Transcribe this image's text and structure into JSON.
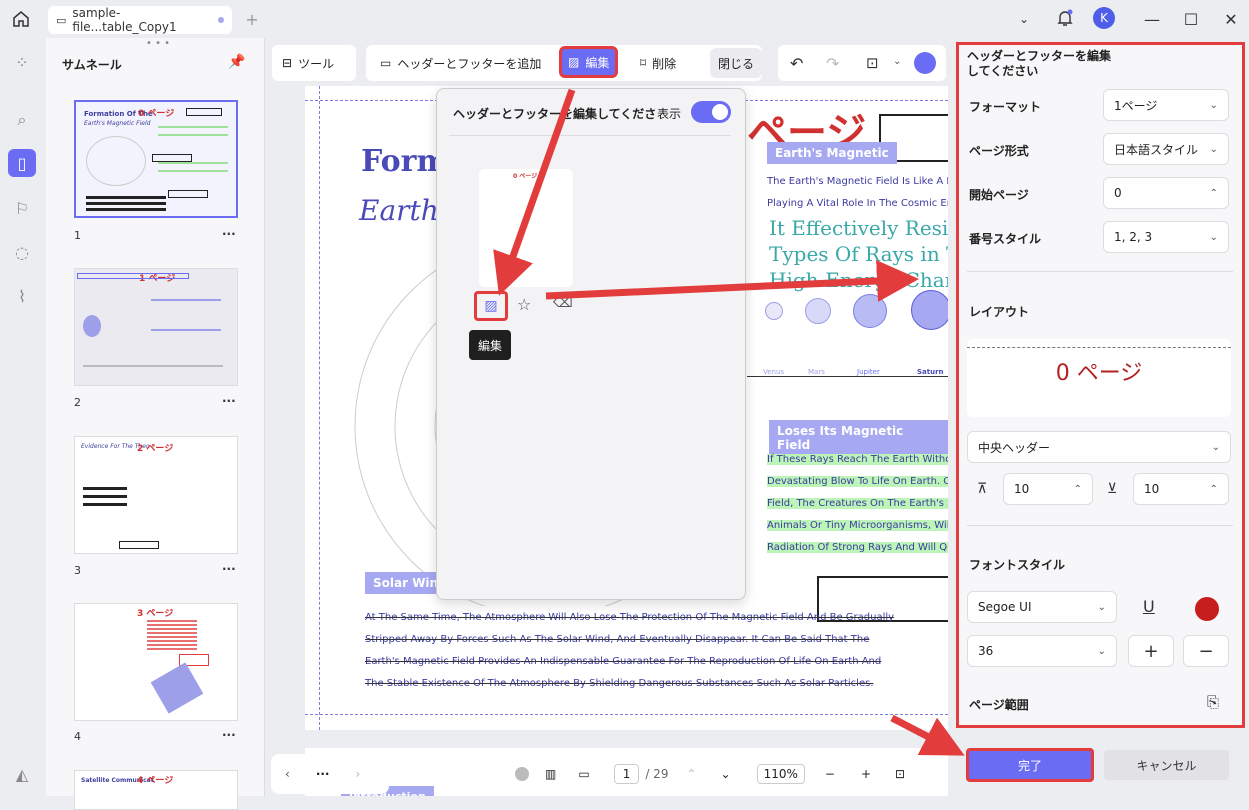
{
  "titlebar": {
    "tab_title": "sample-file...table_Copy1",
    "avatar_letter": "K"
  },
  "sidebar": {
    "title": "サムネール",
    "pages": [
      {
        "num": "1",
        "label": "0 ページ",
        "heading": "Formation Of The",
        "subheading": "Earth's Magnetic Field"
      },
      {
        "num": "2",
        "label": "1 ページ"
      },
      {
        "num": "3",
        "label": "2 ページ",
        "heading": "Evidence For The Theo"
      },
      {
        "num": "4",
        "label": "3 ページ"
      },
      {
        "num": "",
        "label": "4 ページ",
        "heading": "Satellite Communicat"
      }
    ],
    "more": "···"
  },
  "toolbar": {
    "tools": "ツール",
    "add_header_footer": "ヘッダーとフッターを追加",
    "edit": "編集",
    "delete": "削除",
    "close": "閉じる"
  },
  "document": {
    "title1": "Form",
    "title2": "Earth",
    "page_label_big": "ページ",
    "tag_magnetic": "Earth's Magnetic",
    "line1": "The Earth's Magnetic Field Is Like A Hug",
    "line2": "Playing A Vital Role In The Cosmic Envi",
    "big1": "It Effectively Resist",
    "big2": "Types Of Rays in Th",
    "big3": "High-Energy Charge",
    "planets": [
      "Venus",
      "Mars",
      "Jupiter",
      "Saturn"
    ],
    "tag_loses": "Loses Its Magnetic Field",
    "green_lines": [
      "If These Rays Reach The Earth Without",
      "Devastating Blow To Life On Earth. Onc",
      "Field, The Creatures On The Earth's Sur",
      "Animals Or Tiny Microorganisms, Will Fi",
      "Radiation Of Strong Rays And Will Quic"
    ],
    "tag_solar": "Solar Wind",
    "strike_lines": [
      "At The Same Time, The Atmosphere Will Also Lose The Protection Of The Magnetic Field And Be Gradually",
      "Stripped Away By Forces Such As The Solar Wind, And Eventually Disappear. It Can Be Said That The",
      "Earth's Magnetic Field Provides An Indispensable Guarantee For The Reproduction Of Life On Earth And",
      "The Stable Existence Of The Atmosphere By Shielding Dangerous Substances Such As Solar Particles."
    ],
    "page2_tag": "Introduction"
  },
  "popup": {
    "title": "ヘッダーとフッターを編集してくださ",
    "show_label": "表示",
    "thumb_label": "0 ページ",
    "tooltip": "編集"
  },
  "panel": {
    "title": "ヘッダーとフッターを編集してください",
    "format_label": "フォーマット",
    "format_value": "1ページ",
    "page_style_label": "ページ形式",
    "page_style_value": "日本語スタイル",
    "start_page_label": "開始ページ",
    "start_page_value": "0",
    "number_style_label": "番号スタイル",
    "number_style_value": "1, 2, 3",
    "layout_label": "レイアウト",
    "layout_preview": "0 ページ",
    "position_value": "中央ヘッダー",
    "top_margin": "10",
    "bottom_margin": "10",
    "font_style_label": "フォントスタイル",
    "font_value": "Segoe UI",
    "size_value": "36",
    "page_range_label": "ページ範囲",
    "font_color": "#c61d1d"
  },
  "bottom": {
    "page_current": "1",
    "page_total": "/ 29",
    "zoom": "110%",
    "done": "完了",
    "cancel": "キャンセル",
    "more": "···"
  },
  "colors": {
    "accent": "#6a6df3",
    "highlight": "#e23c3c"
  }
}
